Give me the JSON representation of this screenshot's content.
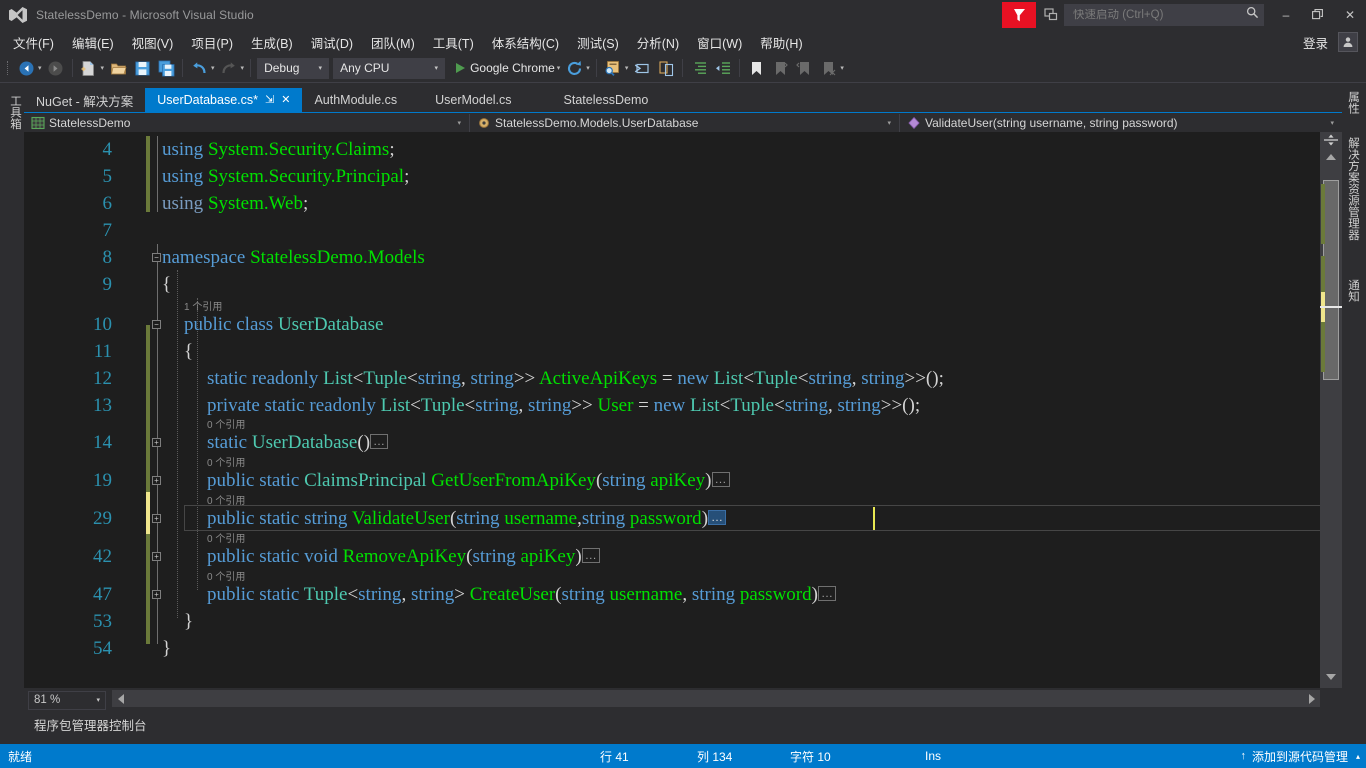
{
  "window": {
    "title": "StatelessDemo - Microsoft Visual Studio",
    "minimize_label": "–",
    "restore_label": "❐",
    "close_label": "✕"
  },
  "quick_launch": {
    "placeholder": "快速启动 (Ctrl+Q)",
    "value": ""
  },
  "menubar": {
    "items": [
      {
        "label": "文件(F)"
      },
      {
        "label": "编辑(E)"
      },
      {
        "label": "视图(V)"
      },
      {
        "label": "项目(P)"
      },
      {
        "label": "生成(B)"
      },
      {
        "label": "调试(D)"
      },
      {
        "label": "团队(M)"
      },
      {
        "label": "工具(T)"
      },
      {
        "label": "体系结构(C)"
      },
      {
        "label": "测试(S)"
      },
      {
        "label": "分析(N)"
      },
      {
        "label": "窗口(W)"
      },
      {
        "label": "帮助(H)"
      }
    ],
    "signin_label": "登录"
  },
  "toolbar": {
    "config_value": "Debug",
    "platform_value": "Any CPU",
    "run_target_label": "Google Chrome"
  },
  "rails": {
    "left_tab": "工具箱",
    "right_tabs": [
      "属性",
      "解决方案资源管理器",
      "通知"
    ]
  },
  "tabs": [
    {
      "label": "NuGet - 解决方案",
      "active": false
    },
    {
      "label": "UserDatabase.cs*",
      "active": true,
      "pin": "⇲",
      "close": "✕"
    },
    {
      "label": "AuthModule.cs",
      "active": false
    },
    {
      "label": "UserModel.cs",
      "active": false
    },
    {
      "label": "StatelessDemo",
      "active": false
    }
  ],
  "navbar": {
    "project": "StatelessDemo",
    "type": "StatelessDemo.Models.UserDatabase",
    "member": "ValidateUser(string username, string password)",
    "arrow": "▾"
  },
  "codelens": {
    "one_ref": "1 个引用",
    "zero_ref": "0 个引用"
  },
  "editor": {
    "ellipsis": "…",
    "lines": [
      {
        "num": "4"
      },
      {
        "num": "5"
      },
      {
        "num": "6"
      },
      {
        "num": "7"
      },
      {
        "num": "8"
      },
      {
        "num": "9"
      },
      {
        "num": "10"
      },
      {
        "num": "11"
      },
      {
        "num": "12"
      },
      {
        "num": "13"
      },
      {
        "num": "14"
      },
      {
        "num": "19"
      },
      {
        "num": "29"
      },
      {
        "num": "42"
      },
      {
        "num": "47"
      },
      {
        "num": "53"
      },
      {
        "num": "54"
      }
    ],
    "code": {
      "l4": {
        "kw": "using",
        "ns1": "System.Security.Claims",
        "semi": ";"
      },
      "l5": {
        "kw": "using",
        "ns1": "System.Security.Principal",
        "semi": ";"
      },
      "l6": {
        "kw": "using",
        "ns1": "System.Web",
        "semi": ";"
      },
      "l8": {
        "kw": "namespace",
        "ns1": "StatelessDemo.Models"
      },
      "l9": {
        "brace": "{"
      },
      "l10": {
        "kw1": "public",
        "kw2": "class",
        "type": "UserDatabase"
      },
      "l11": {
        "brace": "{"
      },
      "l12": {
        "text": "static readonly List<Tuple<string, string>> ActiveApiKeys = new List<Tuple<string, string>>();"
      },
      "l13": {
        "text": "private static readonly List<Tuple<string, string>> User = new List<Tuple<string, string>>();"
      },
      "l14": {
        "text": "static UserDatabase()"
      },
      "l19": {
        "text": "public static ClaimsPrincipal GetUserFromApiKey(string apiKey)"
      },
      "l29": {
        "text": "public static string ValidateUser(string username,string password)"
      },
      "l42": {
        "text": "public static void RemoveApiKey(string apiKey)"
      },
      "l47": {
        "text": "public static Tuple<string, string> CreateUser(string username, string password)"
      },
      "l53": {
        "brace": "}"
      },
      "l54": {
        "brace": "}"
      }
    }
  },
  "zoom": {
    "value": "81 %",
    "arrow": "▾"
  },
  "bottom_panel": {
    "tab_label": "程序包管理器控制台"
  },
  "statusbar": {
    "ready": "就绪",
    "line_label": "行 41",
    "col_label": "列 134",
    "char_label": "字符 10",
    "insert_mode": "Ins",
    "source_control": "添加到源代码管理",
    "up_arrow": "↑",
    "caret_up": "▴"
  },
  "colors": {
    "accent": "#007acc",
    "titlebar_bg": "#2d2d30",
    "editor_bg": "#1e1e1e",
    "feedback_red": "#e81123",
    "keyword": "#569cd6",
    "type": "#4ec9b0",
    "identifier": "#00e000",
    "punctuation": "#d4d4d4",
    "linenum": "#2b91af",
    "change_bar": "#6b7a3a",
    "pending_bar": "#f0e68c"
  }
}
